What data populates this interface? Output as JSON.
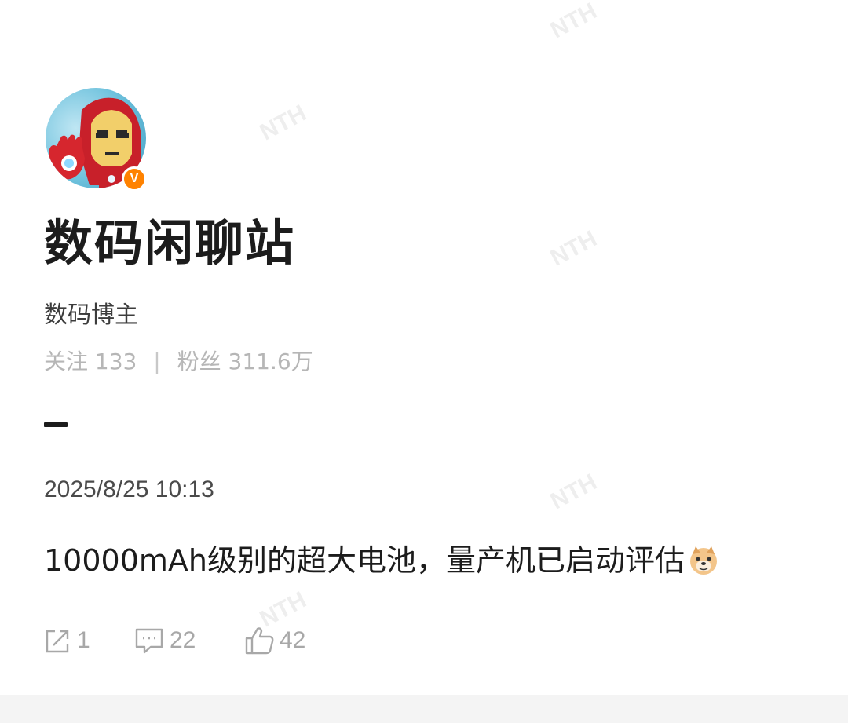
{
  "profile": {
    "name": "数码闲聊站",
    "role": "数码博主",
    "following_label": "关注",
    "following_count": "133",
    "separator": "|",
    "followers_label": "粉丝",
    "followers_count": "311.6万",
    "verified_badge": "V",
    "avatar_icon": "iron-man-avatar-icon"
  },
  "post": {
    "timestamp": "2025/8/25 10:13",
    "text": "10000mAh级别的超大电池，量产机已启动评估",
    "emoji_icon": "doge-emoji-icon"
  },
  "actions": {
    "repost_count": "1",
    "comment_count": "22",
    "like_count": "42"
  },
  "colors": {
    "badge": "#ff8200",
    "muted_text": "#b6b6b6",
    "action_icon": "#a8a8a8"
  }
}
